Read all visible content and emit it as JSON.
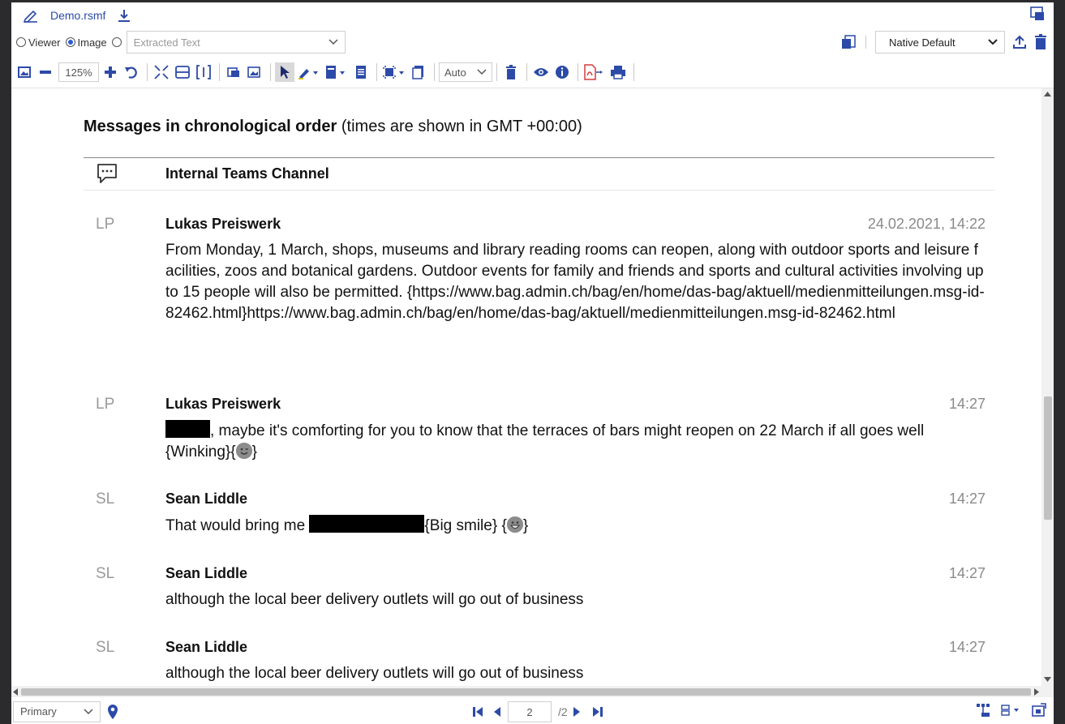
{
  "titlebar": {
    "file_name": "Demo.rsmf"
  },
  "modebar": {
    "viewer_label": "Viewer",
    "image_label": "Image",
    "extracted_label": "Extracted Text",
    "selected_mode": "Image",
    "profile_value": "Native Default"
  },
  "toolbar": {
    "zoom_value": "125%",
    "fit_value": "Auto"
  },
  "document": {
    "heading_bold": "Messages in chronological order",
    "heading_rest": " (times are shown in GMT +00:00)",
    "channel_name": "Internal Teams Channel",
    "messages": [
      {
        "initials": "LP",
        "author": "Lukas Preiswerk",
        "time": "24.02.2021, 14:22",
        "text": "From Monday, 1 March, shops, museums and library reading rooms can reopen, along with outdoor sports and leisure facilities, zoos and botanical gardens. Outdoor events for family and friends and sports and cultural activities involving up to 15 people will also be permitted. {https://www.bag.admin.ch/bag/en/home/das-bag/aktuell/medienmitteilungen.msg-id-82462.html}https://www.bag.admin.ch/bag/en/home/das-bag/aktuell/medienmitteilungen.msg-id-82462.html"
      },
      {
        "initials": "LP",
        "author": "Lukas Preiswerk",
        "time": "14:27",
        "text_after_redaction": ", maybe it's comforting for you to know that the terraces of bars might reopen on 22 March if all goes well {Winking}{",
        "text_end": "}"
      },
      {
        "initials": "SL",
        "author": "Sean Liddle",
        "time": "14:27",
        "text_before": "That would bring me ",
        "text_after": "{Big smile} {",
        "text_end": "}"
      },
      {
        "initials": "SL",
        "author": "Sean Liddle",
        "time": "14:27",
        "text": "although the local beer delivery outlets will go out of business"
      },
      {
        "initials": "SL",
        "author": "Sean Liddle",
        "time": "14:27",
        "text": "although the local beer delivery outlets will go out of business"
      }
    ]
  },
  "statusbar": {
    "view_select": "Primary",
    "page_current": "2",
    "page_total": "/2"
  },
  "colors": {
    "accent": "#2c4aa8",
    "redaction": "#000000"
  }
}
